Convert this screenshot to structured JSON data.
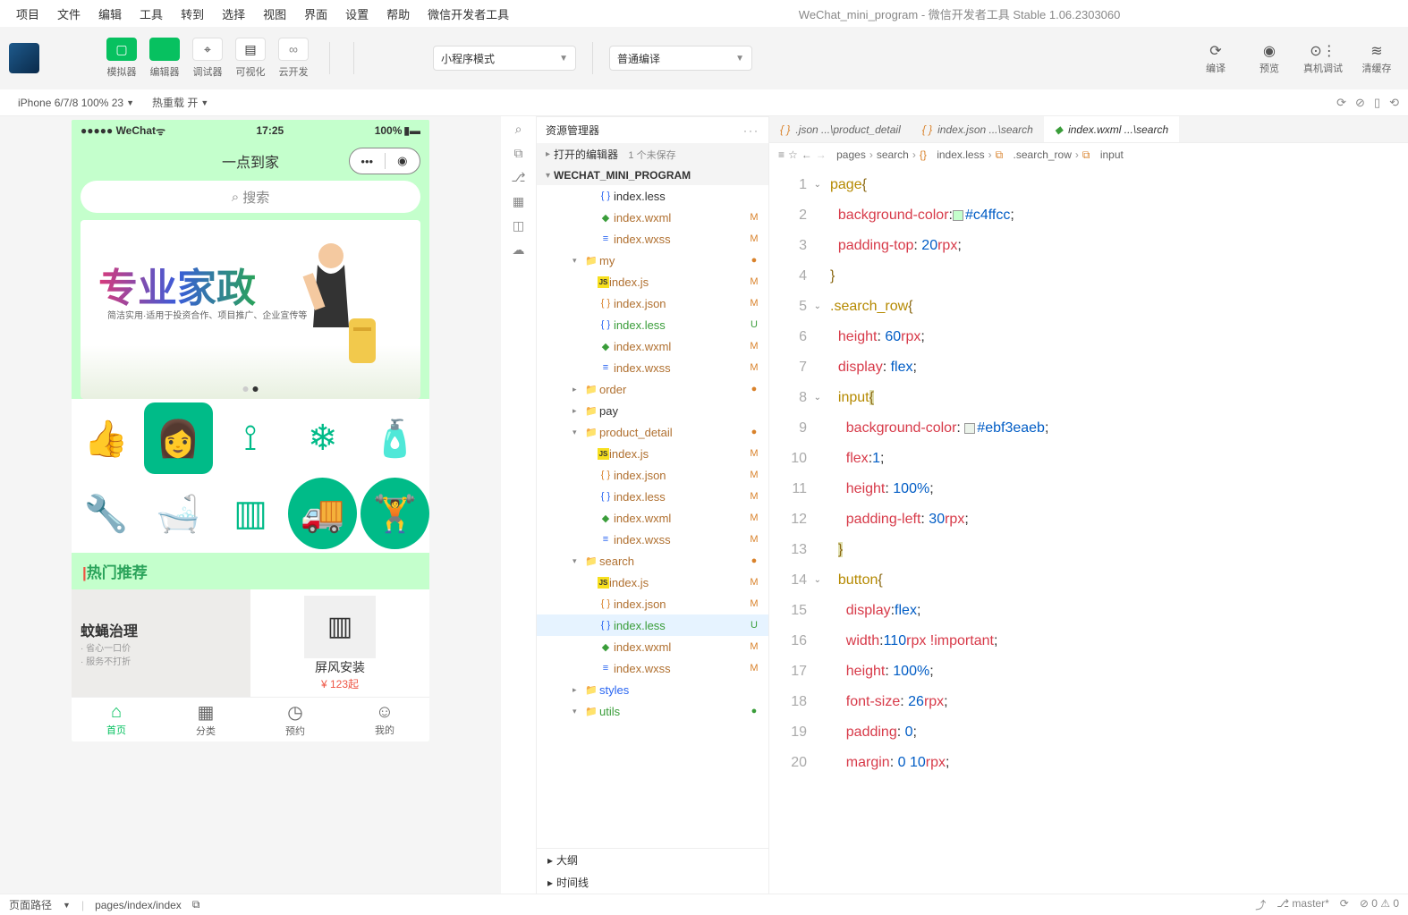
{
  "window": {
    "title": "WeChat_mini_program - 微信开发者工具 Stable 1.06.2303060"
  },
  "menubar": [
    "项目",
    "文件",
    "编辑",
    "工具",
    "转到",
    "选择",
    "视图",
    "界面",
    "设置",
    "帮助",
    "微信开发者工具"
  ],
  "toolbar": {
    "buttons": [
      {
        "label": "模拟器",
        "icon": "▢",
        "green": true
      },
      {
        "label": "编辑器",
        "icon": "</>",
        "green": true
      },
      {
        "label": "调试器",
        "icon": "⌖",
        "green": false
      },
      {
        "label": "可视化",
        "icon": "▤",
        "green": false
      },
      {
        "label": "云开发",
        "icon": "∞",
        "green": false,
        "gray": true
      }
    ],
    "mode": "小程序模式",
    "compile": "普通编译",
    "right": [
      {
        "label": "编译",
        "icon": "⟳"
      },
      {
        "label": "预览",
        "icon": "◉"
      },
      {
        "label": "真机调试",
        "icon": "⊙⋮"
      },
      {
        "label": "清缓存",
        "icon": "≋"
      }
    ]
  },
  "devbar": {
    "device": "iPhone 6/7/8 100% 23",
    "reload": "热重载 开"
  },
  "simulator": {
    "status_left": "●●●●● WeChat",
    "status_time": "17:25",
    "status_right": "100%",
    "nav_title": "一点到家",
    "search_placeholder": "搜索",
    "banner_title": "专业家政",
    "banner_sub": "简洁实用·适用于投资合作、项目推广、企业宣传等",
    "hot_label": "热门推荐",
    "prods": [
      {
        "name": "蚊蝇治理",
        "price": ""
      },
      {
        "name": "屏风安装",
        "price": "¥ 123起"
      }
    ],
    "tabs": [
      {
        "label": "首页",
        "icon": "⌂",
        "active": true
      },
      {
        "label": "分类",
        "icon": "▦",
        "active": false
      },
      {
        "label": "预约",
        "icon": "◷",
        "active": false
      },
      {
        "label": "我的",
        "icon": "☺",
        "active": false
      }
    ]
  },
  "explorer": {
    "title": "资源管理器",
    "open_editors": "打开的编辑器",
    "open_unsaved": "1 个未保存",
    "project": "WECHAT_MINI_PROGRAM",
    "tree": [
      {
        "d": 3,
        "ico": "less",
        "name": "index.less",
        "stat": ""
      },
      {
        "d": 3,
        "ico": "wxml",
        "name": "index.wxml",
        "stat": "M"
      },
      {
        "d": 3,
        "ico": "wxss",
        "name": "index.wxss",
        "stat": "M"
      },
      {
        "d": 2,
        "ico": "folder",
        "name": "my",
        "stat": "dot",
        "chev": "▾"
      },
      {
        "d": 3,
        "ico": "js",
        "name": "index.js",
        "stat": "M"
      },
      {
        "d": 3,
        "ico": "json",
        "name": "index.json",
        "stat": "M"
      },
      {
        "d": 3,
        "ico": "less",
        "name": "index.less",
        "stat": "U"
      },
      {
        "d": 3,
        "ico": "wxml",
        "name": "index.wxml",
        "stat": "M"
      },
      {
        "d": 3,
        "ico": "wxss",
        "name": "index.wxss",
        "stat": "M"
      },
      {
        "d": 2,
        "ico": "folder",
        "name": "order",
        "stat": "dot",
        "chev": "▸"
      },
      {
        "d": 2,
        "ico": "folder",
        "name": "pay",
        "stat": "",
        "chev": "▸"
      },
      {
        "d": 2,
        "ico": "folder",
        "name": "product_detail",
        "stat": "dot",
        "chev": "▾"
      },
      {
        "d": 3,
        "ico": "js",
        "name": "index.js",
        "stat": "M"
      },
      {
        "d": 3,
        "ico": "json",
        "name": "index.json",
        "stat": "M"
      },
      {
        "d": 3,
        "ico": "less",
        "name": "index.less",
        "stat": "M"
      },
      {
        "d": 3,
        "ico": "wxml",
        "name": "index.wxml",
        "stat": "M"
      },
      {
        "d": 3,
        "ico": "wxss",
        "name": "index.wxss",
        "stat": "M"
      },
      {
        "d": 2,
        "ico": "folder",
        "name": "search",
        "stat": "dot",
        "chev": "▾"
      },
      {
        "d": 3,
        "ico": "js",
        "name": "index.js",
        "stat": "M"
      },
      {
        "d": 3,
        "ico": "json",
        "name": "index.json",
        "stat": "M"
      },
      {
        "d": 3,
        "ico": "less",
        "name": "index.less",
        "stat": "U",
        "selected": true
      },
      {
        "d": 3,
        "ico": "wxml",
        "name": "index.wxml",
        "stat": "M"
      },
      {
        "d": 3,
        "ico": "wxss",
        "name": "index.wxss",
        "stat": "M"
      },
      {
        "d": 2,
        "ico": "folder",
        "name": "styles",
        "stat": "",
        "chev": "▸",
        "blue": true
      },
      {
        "d": 2,
        "ico": "folder",
        "name": "utils",
        "stat": "gdot",
        "chev": "▾",
        "green": true
      }
    ],
    "bottom": [
      "大纲",
      "时间线"
    ]
  },
  "editor_tabs": [
    {
      "ico": "json",
      "label": ".json ...\\product_detail"
    },
    {
      "ico": "json",
      "label": "index.json ...\\search"
    },
    {
      "ico": "wxml",
      "label": "index.wxml ...\\search",
      "active": true
    }
  ],
  "breadcrumbs": [
    "pages",
    "search",
    "index.less",
    ".search_row",
    "input"
  ],
  "code": [
    {
      "n": 1,
      "fold": "v",
      "html": "<span class='tok-sel'>page</span><span class='tok-brace'>{</span>"
    },
    {
      "n": 2,
      "html": "  <span class='tok-prop'>background-color</span>:<span class='swatch' style='background:#c4ffcc'></span><span class='tok-hex'>#c4ffcc</span>;"
    },
    {
      "n": 3,
      "html": "  <span class='tok-prop'>padding-top</span>: <span class='tok-num'>20</span><span class='tok-unit'>rpx</span>;"
    },
    {
      "n": 4,
      "html": "<span class='tok-brace'>}</span>"
    },
    {
      "n": 5,
      "fold": "v",
      "html": "<span class='tok-sel'>.search_row</span><span class='tok-brace'>{</span>"
    },
    {
      "n": 6,
      "html": "  <span class='tok-prop'>height</span>: <span class='tok-num'>60</span><span class='tok-unit'>rpx</span>;"
    },
    {
      "n": 7,
      "html": "  <span class='tok-prop'>display</span>: <span class='tok-val'>flex</span>;"
    },
    {
      "n": 8,
      "fold": "v",
      "html": "  <span class='tok-sel'>input</span><span class='tok-brace hl-close'>{</span>"
    },
    {
      "n": 9,
      "html": "    <span class='tok-prop'>background-color</span>: <span class='swatch' style='background:#ebf3ea'></span><span class='tok-hex'>#ebf3eaeb</span>;"
    },
    {
      "n": 10,
      "html": "    <span class='tok-prop'>flex</span>:<span class='tok-num'>1</span>;"
    },
    {
      "n": 11,
      "html": "    <span class='tok-prop'>height</span>: <span class='tok-num'>100%</span>;"
    },
    {
      "n": 12,
      "html": "    <span class='tok-prop'>padding-left</span>: <span class='tok-num'>30</span><span class='tok-unit'>rpx</span>;"
    },
    {
      "n": 13,
      "html": "  <span class='tok-brace hl-close'>}</span>"
    },
    {
      "n": 14,
      "fold": "v",
      "html": "  <span class='tok-sel'>button</span><span class='tok-brace'>{</span>"
    },
    {
      "n": 15,
      "html": "    <span class='tok-prop'>display</span>:<span class='tok-val'>flex</span>;"
    },
    {
      "n": 16,
      "html": "    <span class='tok-prop'>width</span>:<span class='tok-num'>110</span><span class='tok-unit'>rpx</span> <span class='tok-imp'>!important</span>;"
    },
    {
      "n": 17,
      "html": "    <span class='tok-prop'>height</span>: <span class='tok-num'>100%</span>;"
    },
    {
      "n": 18,
      "html": "    <span class='tok-prop'>font-size</span>: <span class='tok-num'>26</span><span class='tok-unit'>rpx</span>;"
    },
    {
      "n": 19,
      "html": "    <span class='tok-prop'>padding</span>: <span class='tok-num'>0</span>;"
    },
    {
      "n": 20,
      "html": "    <span class='tok-prop'>margin</span>: <span class='tok-num'>0</span> <span class='tok-num'>10</span><span class='tok-unit'>rpx</span>;"
    }
  ],
  "status": {
    "path_label": "页面路径",
    "path": "pages/index/index",
    "branch": "master*",
    "errwarn": "⊘ 0 ⚠ 0"
  }
}
